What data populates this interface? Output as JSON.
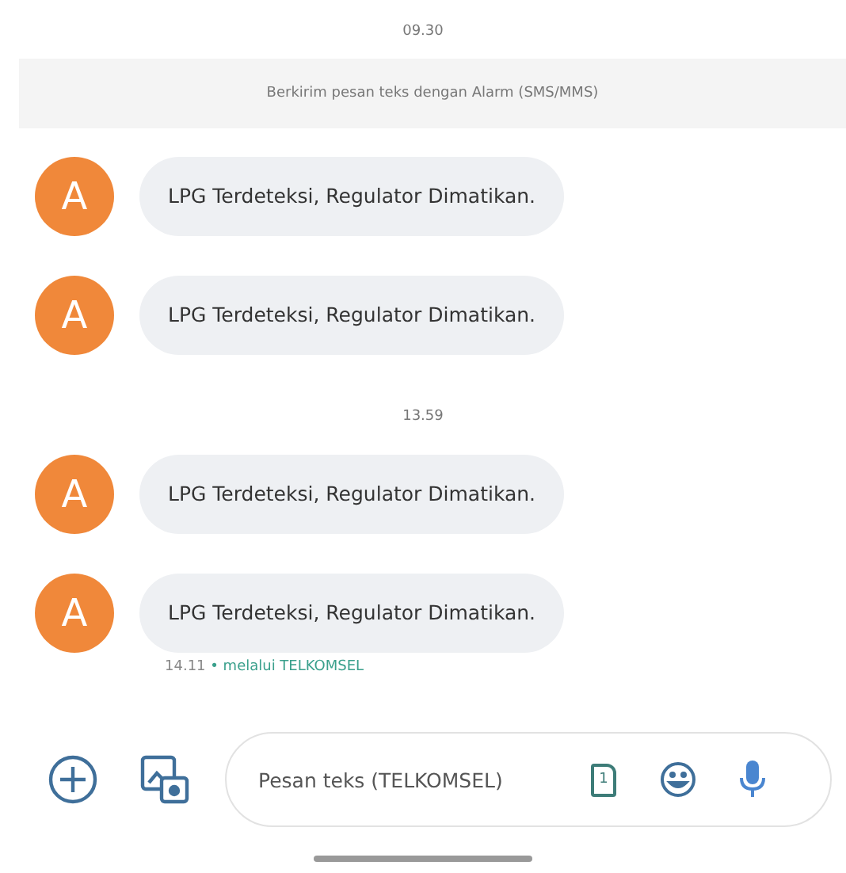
{
  "thread": [
    {
      "kind": "time",
      "text": "09.30"
    },
    {
      "kind": "notice",
      "text": "Berkirim pesan teks dengan Alarm (SMS/MMS)"
    },
    {
      "kind": "message",
      "avatar": "A",
      "text": "LPG Terdeteksi, Regulator Dimatikan."
    },
    {
      "kind": "message",
      "avatar": "A",
      "text": "LPG Terdeteksi, Regulator Dimatikan."
    },
    {
      "kind": "time",
      "text": "13.59"
    },
    {
      "kind": "message",
      "avatar": "A",
      "text": "LPG Terdeteksi, Regulator Dimatikan."
    },
    {
      "kind": "message",
      "avatar": "A",
      "text": "LPG Terdeteksi, Regulator Dimatikan."
    }
  ],
  "delivery": {
    "time": "14.11",
    "separator": "•",
    "via": "melalui TELKOMSEL"
  },
  "composer": {
    "placeholder": "Pesan teks (TELKOMSEL)",
    "sim_slot": "1"
  }
}
